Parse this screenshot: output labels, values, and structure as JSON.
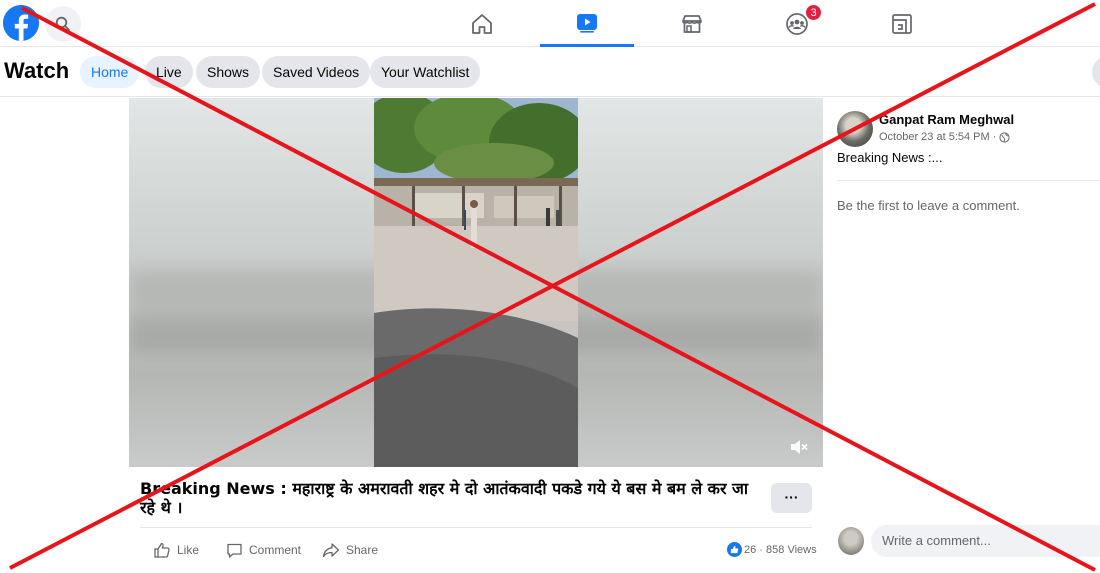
{
  "nav": {
    "logo_icon": "facebook-logo-icon",
    "tabs": [
      {
        "name": "home",
        "icon": "home-icon",
        "active": false
      },
      {
        "name": "watch",
        "icon": "video-play-icon",
        "active": true
      },
      {
        "name": "marketplace",
        "icon": "store-icon",
        "active": false
      },
      {
        "name": "groups",
        "icon": "groups-icon",
        "active": false,
        "badge": "3"
      },
      {
        "name": "gaming",
        "icon": "gaming-icon",
        "active": false
      }
    ]
  },
  "subnav": {
    "title": "Watch",
    "pills": [
      {
        "label": "Home",
        "active": true
      },
      {
        "label": "Live"
      },
      {
        "label": "Shows"
      },
      {
        "label": "Saved Videos"
      },
      {
        "label": "Your Watchlist"
      }
    ]
  },
  "post": {
    "text": "Breaking News : महाराष्ट्र के अमरावती शहर मे दो आतंकवादी पकडे गये ये बस मे बम ले कर जा रहे थे ।",
    "more_label": "···",
    "actions": {
      "like": "Like",
      "comment": "Comment",
      "share": "Share"
    },
    "reaction_count": "26",
    "views": "858 Views",
    "stats_separator": " · "
  },
  "sidebar": {
    "author": "Ganpat Ram Meghwal",
    "timestamp": "October 23 at 5:54 PM ·",
    "post_text": "Breaking News :...",
    "empty_comments": "Be the first to leave a comment.",
    "comment_placeholder": "Write a comment..."
  },
  "colors": {
    "accent": "#1877f2",
    "badge": "#e41e3f",
    "overlay_cross": "#e8141b"
  }
}
